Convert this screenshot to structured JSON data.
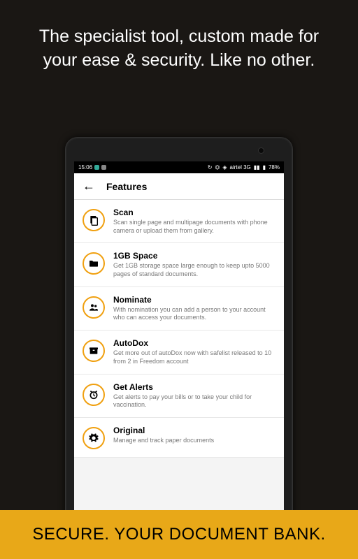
{
  "hero": "The specialist tool, custom made for your ease & security. Like no other.",
  "statusbar": {
    "time": "15:06",
    "carrier": "airtel 3G",
    "battery": "78%"
  },
  "header": {
    "title": "Features"
  },
  "features": [
    {
      "icon": "scan",
      "title": "Scan",
      "desc": "Scan single page and multipage documents with phone camera or upload them from gallery."
    },
    {
      "icon": "folder",
      "title": "1GB Space",
      "desc": "Get 1GB storage space large enough to keep upto 5000 pages of standard documents."
    },
    {
      "icon": "people",
      "title": "Nominate",
      "desc": "With nomination you can add a person to your account who can access your documents."
    },
    {
      "icon": "box",
      "title": "AutoDox",
      "desc": "Get more out of autoDox now with safelist released to 10 from 2 in Freedom account"
    },
    {
      "icon": "alarm",
      "title": "Get Alerts",
      "desc": "Get alerts to pay your bills or to take your child for vaccination."
    },
    {
      "icon": "gear",
      "title": "Original",
      "desc": "Manage and track paper documents"
    }
  ],
  "banner": "SECURE. YOUR DOCUMENT BANK."
}
